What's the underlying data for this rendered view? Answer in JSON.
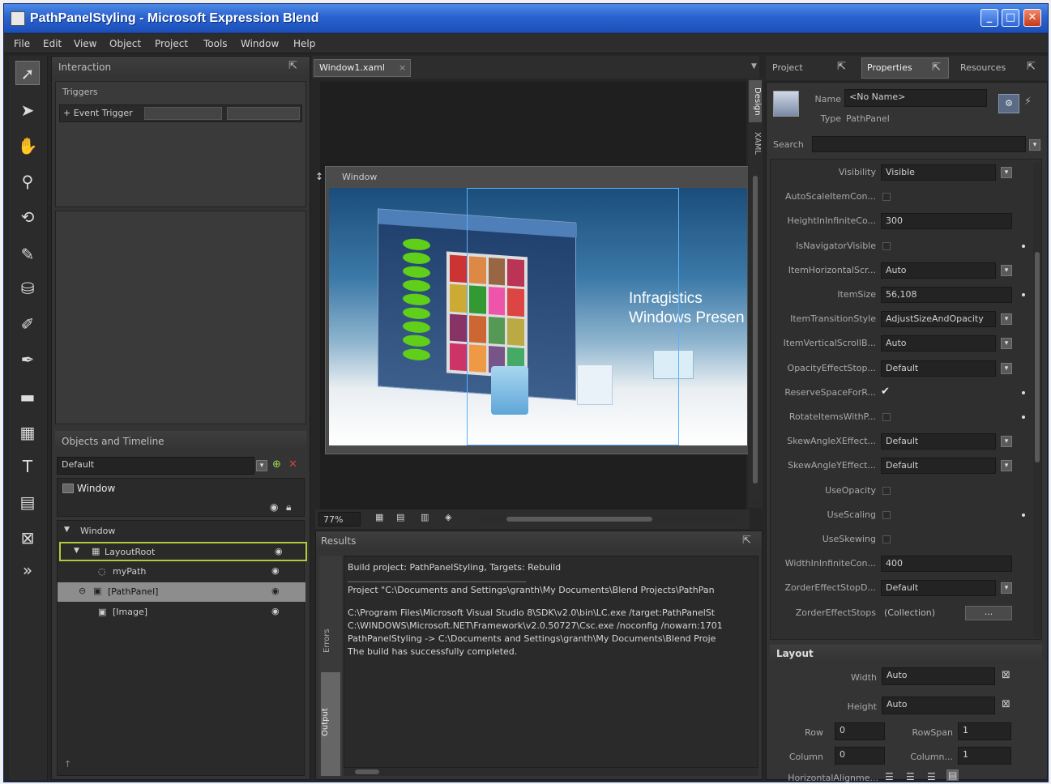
{
  "app": {
    "title": "PathPanelStyling - Microsoft Expression Blend",
    "window_buttons": {
      "minimize": "_",
      "maximize": "□",
      "close": "✕"
    }
  },
  "menu": [
    "File",
    "Edit",
    "View",
    "Object",
    "Project",
    "Tools",
    "Window",
    "Help"
  ],
  "tools": [
    {
      "icon": "selection-icon"
    },
    {
      "icon": "direct-select-icon"
    },
    {
      "icon": "pan-hand-icon"
    },
    {
      "icon": "zoom-icon"
    },
    {
      "icon": "camera-orbit-icon"
    },
    {
      "icon": "eyedropper-icon"
    },
    {
      "icon": "paint-bucket-icon"
    },
    {
      "icon": "brush-transform-icon"
    },
    {
      "icon": "pen-icon"
    },
    {
      "icon": "rectangle-icon"
    },
    {
      "icon": "grid-icon"
    },
    {
      "icon": "text-icon"
    },
    {
      "icon": "controls-icon"
    },
    {
      "icon": "asset-library-icon"
    },
    {
      "icon": "more-tools-icon"
    }
  ],
  "interaction": {
    "title": "Interaction",
    "triggers_label": "Triggers",
    "trigger_item": "+ Event Trigger",
    "trigger_btn2": "",
    "trigger_btn3": "",
    "objects_timeline": "Objects and Timeline",
    "timeline_value": "Default",
    "scope_label": "Window",
    "tree": [
      {
        "label": "Window",
        "indent": 0
      },
      {
        "label": "LayoutRoot",
        "indent": 1
      },
      {
        "label": "myPath",
        "indent": 2
      },
      {
        "label": "[PathPanel]",
        "indent": 1
      },
      {
        "label": "[Image]",
        "indent": 2
      }
    ]
  },
  "document": {
    "tab_label": "Window1.xaml",
    "tab_close": "×",
    "side_tabs": [
      "Design",
      "XAML"
    ],
    "window_title": "Window",
    "scene_text1": "Infragistics",
    "scene_text2": "Windows Presen",
    "zoom": "77%"
  },
  "results": {
    "title": "Results",
    "side_tabs": [
      "Errors",
      "Output"
    ],
    "lines": [
      "Build project: PathPanelStyling, Targets: Rebuild",
      "________________________________________",
      "Project \"C:\\Documents and Settings\\granth\\My Documents\\Blend Projects\\PathPan",
      "",
      "C:\\Program Files\\Microsoft Visual Studio 8\\SDK\\v2.0\\bin\\LC.exe /target:PathPanelSt",
      "C:\\WINDOWS\\Microsoft.NET\\Framework\\v2.0.50727\\Csc.exe /noconfig /nowarn:1701",
      "PathPanelStyling -> C:\\Documents and Settings\\granth\\My Documents\\Blend Proje",
      "The build has successfully completed."
    ]
  },
  "right_tabs": [
    "Project",
    "Properties",
    "Resources"
  ],
  "properties": {
    "name_label": "Name",
    "name_value": "<No Name>",
    "type_label": "Type",
    "type_value": "PathPanel",
    "search_label": "Search",
    "rows": [
      {
        "label": "Visibility",
        "value": "Visible",
        "kind": "dropdown"
      },
      {
        "label": "AutoScaleItemCon...",
        "value": "",
        "kind": "check"
      },
      {
        "label": "HeightInInfiniteCo...",
        "value": "300",
        "kind": "text"
      },
      {
        "label": "IsNavigatorVisible",
        "value": "",
        "kind": "check"
      },
      {
        "label": "ItemHorizontalScr...",
        "value": "Auto",
        "kind": "dropdown"
      },
      {
        "label": "ItemSize",
        "value": "56,108",
        "kind": "text"
      },
      {
        "label": "ItemTransitionStyle",
        "value": "AdjustSizeAndOpacity",
        "kind": "dropdown"
      },
      {
        "label": "ItemVerticalScrollB...",
        "value": "Auto",
        "kind": "dropdown"
      },
      {
        "label": "OpacityEffectStop...",
        "value": "Default",
        "kind": "dropdown"
      },
      {
        "label": "ReserveSpaceForR...",
        "value": "✔",
        "kind": "checked"
      },
      {
        "label": "RotateItemsWithP...",
        "value": "",
        "kind": "check"
      },
      {
        "label": "SkewAngleXEffect...",
        "value": "Default",
        "kind": "dropdown"
      },
      {
        "label": "SkewAngleYEffect...",
        "value": "Default",
        "kind": "dropdown"
      },
      {
        "label": "UseOpacity",
        "value": "",
        "kind": "check"
      },
      {
        "label": "UseScaling",
        "value": "",
        "kind": "check"
      },
      {
        "label": "UseSkewing",
        "value": "",
        "kind": "check"
      },
      {
        "label": "WidthInInfiniteCon...",
        "value": "400",
        "kind": "text"
      },
      {
        "label": "ZorderEffectStopD...",
        "value": "Default",
        "kind": "dropdown"
      },
      {
        "label": "ZorderEffectStops",
        "value": "(Collection)",
        "kind": "collection"
      }
    ],
    "collection_btn": "...",
    "layout": {
      "title": "Layout",
      "width_label": "Width",
      "width_value": "Auto",
      "height_label": "Height",
      "height_value": "Auto",
      "row_label": "Row",
      "row_value": "0",
      "rowspan_label": "RowSpan",
      "rowspan_value": "1",
      "column_label": "Column",
      "column_value": "0",
      "columnspan_label": "Column...",
      "columnspan_value": "1",
      "halign_label": "HorizontalAlignme..."
    }
  },
  "colors": {
    "titlebar": "#2a63d0",
    "panel": "#343434",
    "selection_outline": "#b6c83a",
    "green_items": "#5fcf1a"
  }
}
